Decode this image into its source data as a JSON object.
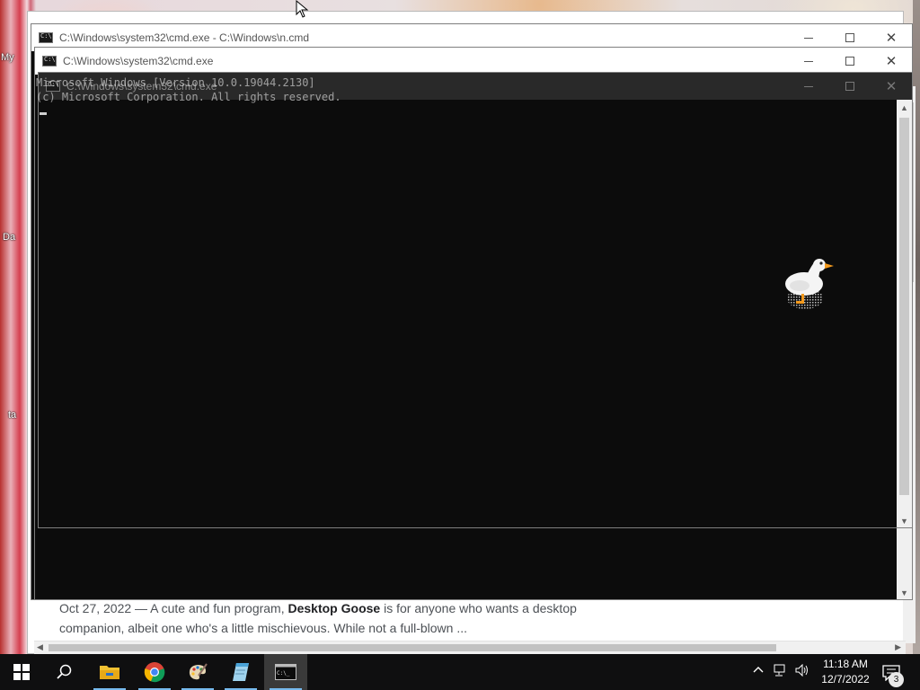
{
  "desktop": {
    "icon_labels": [
      "My",
      "Da",
      "ta"
    ]
  },
  "browser": {
    "snippet_prefix": "Oct 27, 2022 — A cute and fun program, ",
    "snippet_bold": "Desktop Goose",
    "snippet_suffix": " is for anyone who wants a desktop companion, albeit one who's a little mischievous. While not a full-blown ..."
  },
  "windows": [
    {
      "title": "C:\\Windows\\system32\\cmd.exe - C:\\Windows\\n.cmd"
    },
    {
      "title": "C:\\Windows\\system32\\cmd.exe"
    },
    {
      "title": "C:\\Windows\\system32\\cmd.exe"
    }
  ],
  "console": {
    "line1": "Microsoft Windows [Version 10.0.19044.2130]",
    "line2": "(c) Microsoft Corporation. All rights reserved."
  },
  "taskbar": {
    "apps": [
      {
        "name": "start",
        "icon": "windows-logo-icon"
      },
      {
        "name": "search",
        "icon": "search-icon"
      },
      {
        "name": "file-explorer",
        "icon": "folder-icon"
      },
      {
        "name": "chrome",
        "icon": "chrome-icon"
      },
      {
        "name": "paint",
        "icon": "palette-icon"
      },
      {
        "name": "notepad",
        "icon": "notepad-icon"
      },
      {
        "name": "command-prompt",
        "icon": "terminal-icon"
      }
    ],
    "time": "11:18 AM",
    "date": "12/7/2022",
    "notification_count": "3"
  }
}
